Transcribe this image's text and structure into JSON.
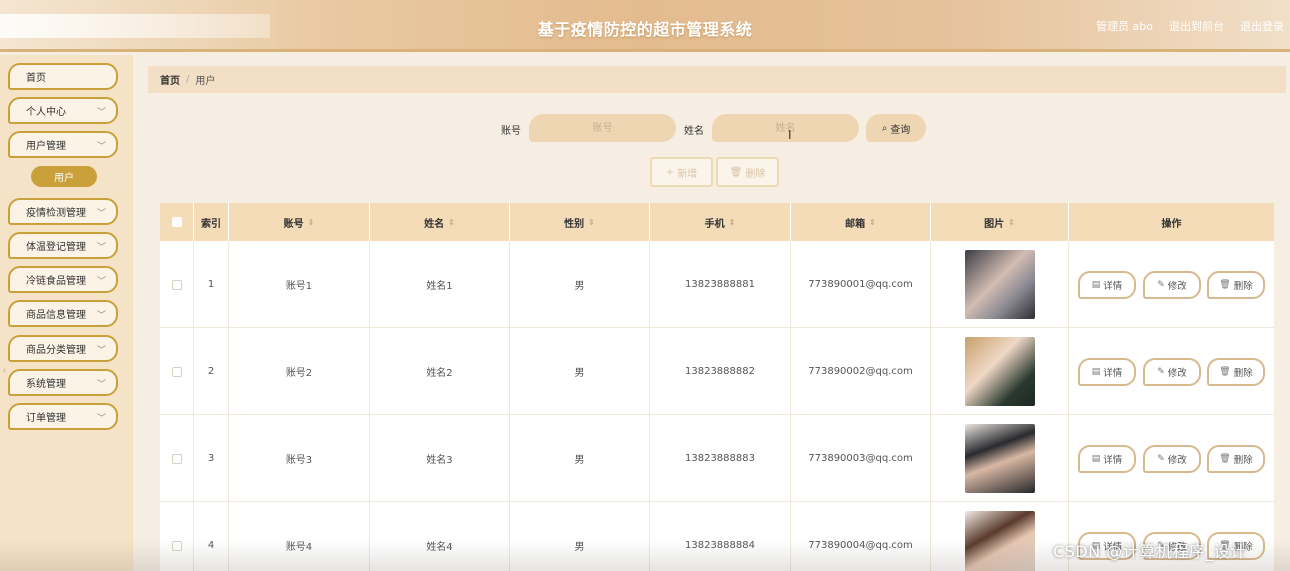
{
  "header": {
    "title": "基于疫情防控的超市管理系统",
    "user_label": "管理员 abo",
    "front_link": "退出到前台",
    "logout_link": "退出登录"
  },
  "sidebar": {
    "items": [
      {
        "label": "首页",
        "has_chevron": false
      },
      {
        "label": "个人中心",
        "has_chevron": true
      },
      {
        "label": "用户管理",
        "has_chevron": true
      },
      {
        "label": "疫情检测管理",
        "has_chevron": true
      },
      {
        "label": "体温登记管理",
        "has_chevron": true
      },
      {
        "label": "冷链食品管理",
        "has_chevron": true
      },
      {
        "label": "商品信息管理",
        "has_chevron": true
      },
      {
        "label": "商品分类管理",
        "has_chevron": true
      },
      {
        "label": "系统管理",
        "has_chevron": true
      },
      {
        "label": "订单管理",
        "has_chevron": true
      }
    ],
    "active_sub": "用户"
  },
  "breadcrumb": {
    "home": "首页",
    "separator": "/",
    "current": "用户"
  },
  "search": {
    "account_label": "账号",
    "account_placeholder": "账号",
    "name_label": "姓名",
    "name_placeholder": "姓名",
    "query_button": "查询"
  },
  "actions": {
    "add": "新增",
    "delete": "删除"
  },
  "table": {
    "headers": [
      "索引",
      "账号",
      "姓名",
      "性别",
      "手机",
      "邮箱",
      "图片",
      "操作"
    ],
    "rows": [
      {
        "index": "1",
        "account": "账号1",
        "name": "姓名1",
        "gender": "男",
        "phone": "13823888881",
        "email": "773890001@qq.com"
      },
      {
        "index": "2",
        "account": "账号2",
        "name": "姓名2",
        "gender": "男",
        "phone": "13823888882",
        "email": "773890002@qq.com"
      },
      {
        "index": "3",
        "account": "账号3",
        "name": "姓名3",
        "gender": "男",
        "phone": "13823888883",
        "email": "773890003@qq.com"
      },
      {
        "index": "4",
        "account": "账号4",
        "name": "姓名4",
        "gender": "男",
        "phone": "13823888884",
        "email": "773890004@qq.com"
      }
    ],
    "row_actions": {
      "detail": "详情",
      "edit": "修改",
      "delete": "删除"
    }
  },
  "watermark": "CSDN @计算机程序_设计",
  "colors": {
    "accent": "#c9a03a",
    "header_bg": "#f4dcb8",
    "input_bg": "#efd6b3",
    "sidebar_bg": "#f5e3c7"
  }
}
